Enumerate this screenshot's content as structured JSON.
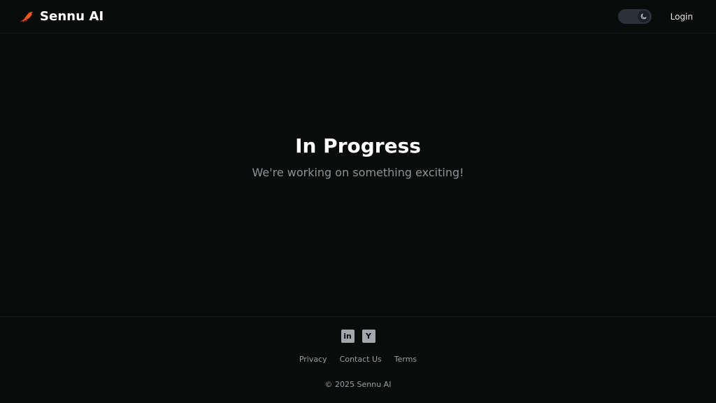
{
  "header": {
    "brand_name": "Sennu AI",
    "logo_icon": "bird-logo-icon",
    "theme_toggle_icon": "moon-icon",
    "login_label": "Login"
  },
  "hero": {
    "title": "In Progress",
    "subtitle": "We're working on something exciting!"
  },
  "footer": {
    "social": [
      {
        "name": "linkedin-icon",
        "glyph": "in"
      },
      {
        "name": "y-combinator-icon",
        "glyph": "Y"
      }
    ],
    "links": [
      "Privacy",
      "Contact Us",
      "Terms"
    ],
    "copyright": "© 2025 Sennu AI"
  },
  "colors": {
    "background": "#0a0b0b",
    "brand_accent": "#f2541b",
    "text_muted": "#8e9196",
    "toggle_bg": "#2c313b"
  }
}
